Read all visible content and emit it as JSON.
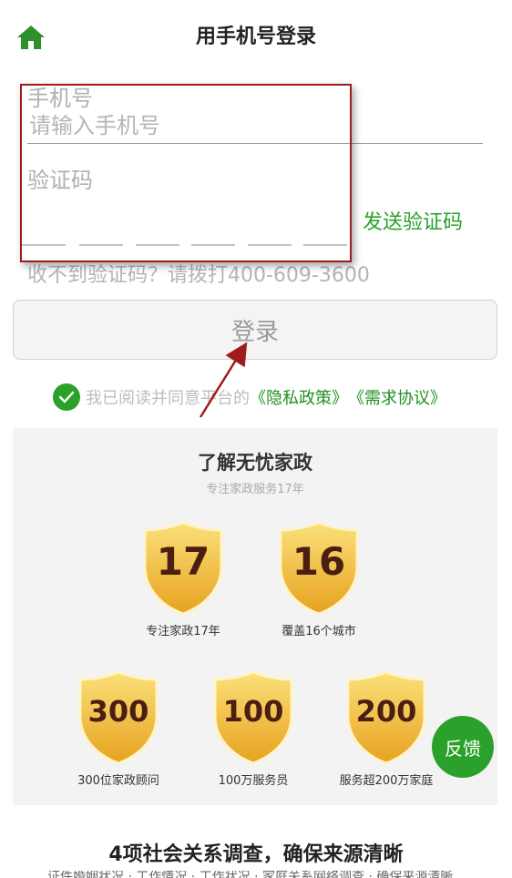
{
  "header": {
    "title": "用手机号登录"
  },
  "form": {
    "phone_label": "手机号",
    "phone_placeholder": "请输入手机号",
    "code_label": "验证码",
    "send_code": "发送验证码",
    "help_text": "收不到验证码？请拨打400-609-3600",
    "login_label": "登录"
  },
  "agreement": {
    "text": "我已阅读并同意平台的",
    "privacy_link": "《隐私政策》",
    "demand_link": "《需求协议》"
  },
  "about": {
    "title": "了解无忧家政",
    "subtitle": "专注家政服务17年",
    "badges": [
      {
        "number": "17",
        "caption": "专注家政17年"
      },
      {
        "number": "16",
        "caption": "覆盖16个城市"
      },
      {
        "number": "300",
        "caption": "300位家政顾问"
      },
      {
        "number": "100",
        "caption": "100万服务员"
      },
      {
        "number": "200",
        "caption": "服务超200万家庭"
      }
    ]
  },
  "feedback": {
    "label": "反馈"
  },
  "bottom": {
    "title": "4项社会关系调查，确保来源清晰",
    "cut_text": "证件婚姻状况 · 工作情况 · 工作状况 · 家庭关系网络调查 · 确保来源清晰"
  },
  "colors": {
    "accent": "#2aa12a",
    "annotation": "#a01c1c",
    "gold": "#f3b62c"
  }
}
